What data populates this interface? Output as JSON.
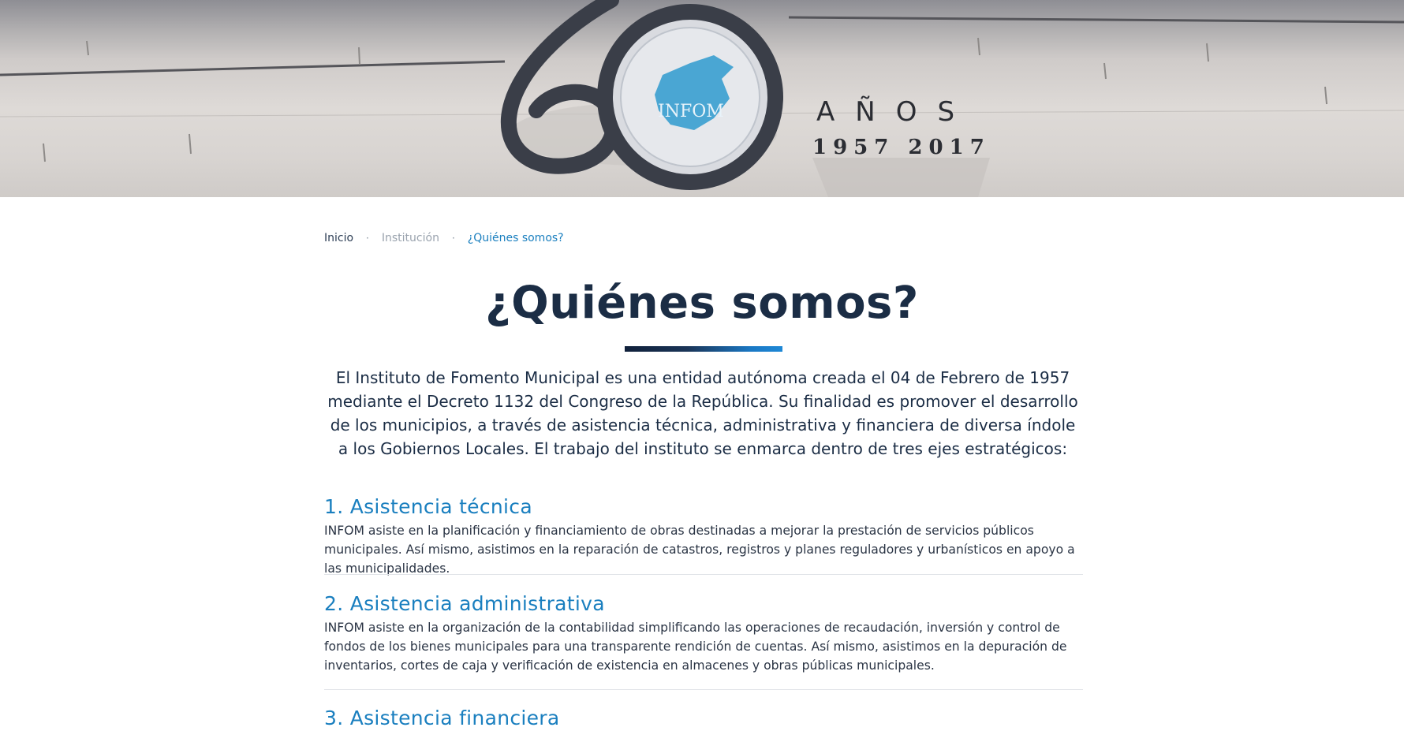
{
  "hero": {
    "sign_number": "60",
    "sign_word": "AÑOS",
    "sign_years": "1957 2017",
    "logo_text": "INFOM"
  },
  "breadcrumb": {
    "items": [
      "Inicio",
      "Institución",
      "¿Quiénes somos?"
    ],
    "separator": "·"
  },
  "page": {
    "title": "¿Quiénes somos?",
    "intro": "El Instituto de Fomento Municipal es una entidad autónoma creada el 04 de Febrero de 1957 mediante el Decreto 1132 del Congreso de la República. Su finalidad es promover el desarrollo de los municipios, a través de asistencia técnica, administrativa y financiera de diversa índole a los Gobiernos Locales. El trabajo del instituto se enmarca dentro de tres ejes estratégicos:"
  },
  "sections": [
    {
      "title": "1. Asistencia técnica",
      "body": "INFOM asiste en la planificación y financiamiento de obras destinadas a mejorar la prestación de servicios públicos municipales. Así mismo, asistimos en la reparación de catastros, registros y planes reguladores y urbanísticos en apoyo a las municipalidades."
    },
    {
      "title": "2. Asistencia administrativa",
      "body": "INFOM asiste en la organización de la contabilidad simplificando las operaciones de recaudación, inversión y control de fondos de los bienes municipales para una transparente rendición de cuentas. Así mismo, asistimos en la depuración de inventarios, cortes de caja y verificación de existencia en almacenes y obras públicas municipales."
    },
    {
      "title": "3. Asistencia financiera"
    }
  ],
  "colors": {
    "accent": "#1a7fbf",
    "heading": "#1b2d45",
    "text": "#2a3444"
  }
}
